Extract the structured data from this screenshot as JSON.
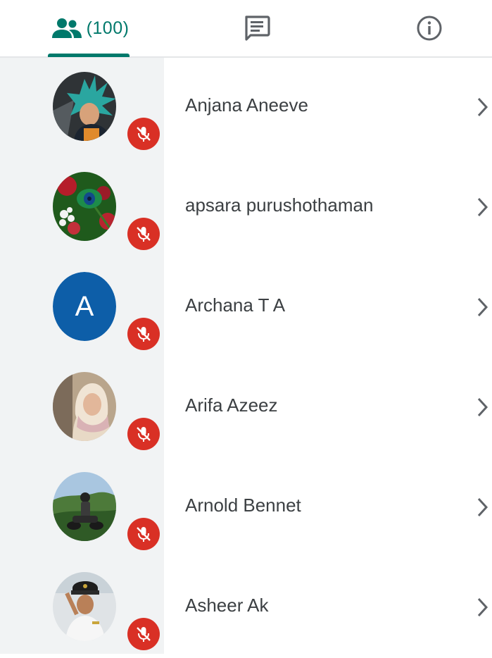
{
  "tabs": {
    "people": {
      "label": "(100)",
      "icon": "people-icon",
      "active": true
    },
    "chat": {
      "icon": "chat-icon"
    },
    "info": {
      "icon": "info-icon"
    }
  },
  "colors": {
    "accent": "#00796b",
    "mute_red": "#d93025",
    "strip_gray": "#f1f3f4",
    "avatar_letter_bg": "#0d5ea8"
  },
  "participants": [
    {
      "name": "Anjana Aneeve",
      "avatar": "photo",
      "muted": true
    },
    {
      "name": "apsara purushothaman",
      "avatar": "photo",
      "muted": true
    },
    {
      "name": "Archana T A",
      "avatar": "letter",
      "initial": "A",
      "muted": true
    },
    {
      "name": "Arifa Azeez",
      "avatar": "photo",
      "muted": true
    },
    {
      "name": "Arnold Bennet",
      "avatar": "photo",
      "muted": true
    },
    {
      "name": "Asheer Ak",
      "avatar": "photo",
      "muted": true
    }
  ]
}
